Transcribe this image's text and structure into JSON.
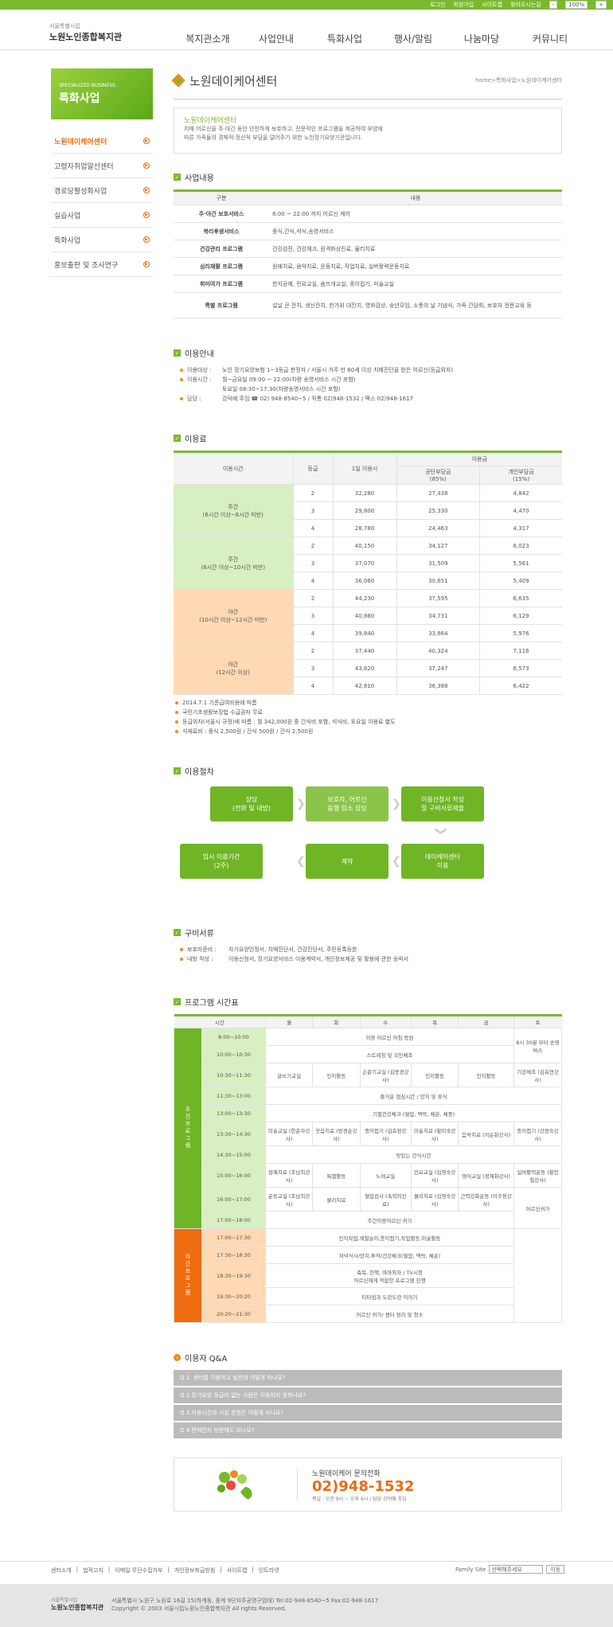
{
  "top_links": [
    "로그인",
    "회원가입",
    "사이트맵",
    "찾아오시는길"
  ],
  "zoom": {
    "minus": "-",
    "value": "100%",
    "plus": "+"
  },
  "logo": {
    "sub": "서울특별시립",
    "name": "노원노인종합복지관"
  },
  "gnb": [
    "복지관소개",
    "사업안내",
    "특화사업",
    "행사/알림",
    "나눔마당",
    "커뮤니티"
  ],
  "lnb_box": {
    "en": "SPECIALIZED BUSINESS",
    "ko": "특화사업"
  },
  "lnb": [
    "노원데이케어센터",
    "고령자취업알선센터",
    "경로당활성화사업",
    "실습사업",
    "특화사업",
    "홍보출판 및 조사연구"
  ],
  "page_title": "노원데이케어센터",
  "breadcrumb": "home>특화사업>노원데이케어센터",
  "intro": {
    "heading": "노원데이케어센터",
    "line1": "치매 어르신을 주·야간 동안 안전하게 보호하고, 전문적인 프로그램을 제공하여 부양에",
    "line2": "따른 가족들의 경제적·정신적 부담을 덜어주기 위한 노인장기요양기관입니다."
  },
  "sec1": {
    "title": "사업내용",
    "col1": "구분",
    "col2": "내용",
    "rows": [
      [
        "주·야간 보호서비스",
        "8:00 ~ 22:00 까지 어르신 케어"
      ],
      [
        "복리후생서비스",
        "중식,간식,석식,송영서비스"
      ],
      [
        "건강관리 프로그램",
        "건강검진, 건강체크, 원격화상진료, 물리치료"
      ],
      [
        "심리재활 프로그램",
        "원예치료, 음악치료, 운동치료, 작업치료, 실버활력운동치료"
      ],
      [
        "취미여가 프로그램",
        "한지공예, 민요교실, 솜뜨개교실, 종이접기, 미술교실"
      ],
      [
        "특별 프로그램",
        "설날 큰 잔치, 생신잔치, 한가위 대잔치, 영화감상, 송년모임, 소풍의 날 기념식, 가족 간담회, 보호자 전문교육 등"
      ]
    ]
  },
  "sec2": {
    "title": "이용안내",
    "rows": [
      {
        "k": "이용대상 :",
        "v": "노인 장기요양보험 1~3등급 판정자 / 서울시 거주 만 60세 이상 치매진단을 받은 어르신(등급외자)"
      },
      {
        "k": "이용시간 :",
        "v": "월~금요일 09:00 ~ 22:00(차량 송영서비스 시간 포함)"
      },
      {
        "k": "",
        "v": "토요일  08:30~17:30(차량송영서비스 시간 포함)"
      },
      {
        "k": "담당 :",
        "v": "강덕예 주임 ☎ 02) 948-8540~5 / 직통 02)948-1532 / 팩스 02)948-1617"
      }
    ]
  },
  "sec3": {
    "title": "이용료",
    "h_time": "이용시간",
    "h_grade": "등급",
    "h_day": "1일 이용시",
    "h_fee": "이용금",
    "h_pub": "공단부담금",
    "h_pub2": "(85%)",
    "h_own": "개인부담금",
    "h_own2": "(15%)",
    "groups": [
      {
        "label1": "주간",
        "label2": "(6시간 이상~8시간 미만)",
        "rows": [
          [
            "2",
            "32,280",
            "27,438",
            "4,842"
          ],
          [
            "3",
            "29,800",
            "25,330",
            "4,470"
          ],
          [
            "4",
            "28,780",
            "24,463",
            "4,317"
          ]
        ]
      },
      {
        "label1": "주간",
        "label2": "(8시간 이상~10시간 미만)",
        "rows": [
          [
            "2",
            "40,150",
            "34,127",
            "6,023"
          ],
          [
            "3",
            "37,070",
            "31,509",
            "5,561"
          ],
          [
            "4",
            "36,060",
            "30,651",
            "5,409"
          ]
        ]
      },
      {
        "label1": "야간",
        "label2": "(10시간 이상~12시간 미만)",
        "rows": [
          [
            "2",
            "44,230",
            "37,595",
            "6,635"
          ],
          [
            "3",
            "40,860",
            "34,731",
            "6,129"
          ],
          [
            "4",
            "39,840",
            "33,864",
            "5,976"
          ]
        ]
      },
      {
        "label1": "야간",
        "label2": "(12시간 이상)",
        "rows": [
          [
            "2",
            "37,440",
            "40,324",
            "7,116"
          ],
          [
            "3",
            "43,820",
            "37,247",
            "6,573"
          ],
          [
            "4",
            "42,810",
            "36,388",
            "6,422"
          ]
        ]
      }
    ],
    "notes": [
      "2014.7.1 기준급여비용에 따름",
      "국민기초생활보장법 수급권자 무료",
      "등급외자(서울시 규정)에 따름 : 월 342,000원 중 간식비 포함, 석식비, 토요일 이용료 별도",
      "식재료비 : 중식 2,500원 / 간식 500원 / 간식 2,500원"
    ]
  },
  "sec4": {
    "title": "이용절차",
    "s1a": "상담",
    "s1b": "(전화 및 내방)",
    "s2a": "보호자, 어르신",
    "s2b": "동행 입소 상담",
    "s3a": "이용신청서 작성",
    "s3b": "및 구비서류제출",
    "s4a": "데이케어센터",
    "s4b": "이용",
    "s5": "계약",
    "s6a": "임시 이용기간",
    "s6b": "(2주)"
  },
  "sec5": {
    "title": "구비서류",
    "rows": [
      {
        "k": "보호자준비 :",
        "v": "자기요양인정서, 치매진단서, 건강진단서, 주민등록등본"
      },
      {
        "k": "내방 작성 :",
        "v": "이용신청서, 장기요양서비스 이용계약서, 개인정보제공 및 활용에 관한 승락서"
      }
    ]
  },
  "sec6": {
    "title": "프로그램 시간표",
    "h": [
      "시간",
      "월",
      "화",
      "수",
      "목",
      "금",
      "토"
    ],
    "day_label": "주간프로그램",
    "night_label": "야간프로그램",
    "r1": {
      "t": "8:00~10:00",
      "v": "이용 어르신 아침 등원",
      "sat": "8시 30분 부터 송영버스"
    },
    "r2": {
      "t": "10:00~10:30",
      "v": "스트레칭 및 국민체조"
    },
    "r3": {
      "t": "10:30~11:30",
      "c": [
        "글쓰기교실",
        "인지활동",
        "손끝기교실 (김봉경강사)",
        "인지활동",
        "인지활동",
        "기공체조 (김옥연강사)"
      ]
    },
    "r4": {
      "t": "11:30~13:00",
      "v": "즐거운 점심시간 / 양치 및 휴식"
    },
    "r5": {
      "t": "13:00~13:30",
      "v": "기별건강체크 (혈압, 맥박, 체온, 체중)"
    },
    "r6": {
      "t": "13:30~14:30",
      "c": [
        "미술교실 (한춘자강사)",
        "웃음치료 (방경순강사)",
        "종이접기 (김효정강사)",
        "미술치료 (황미숙강사)",
        "음악치료 (이순화강사)",
        "종이접기 (강정숙강사)"
      ]
    },
    "r7": {
      "t": "14:30~15:00",
      "v": "맛있는 간식시간"
    },
    "r8": {
      "t": "15:00~16:00",
      "c": [
        "원예치료 (조남희강사)",
        "특별활동",
        "노래교실",
        "민요교실 (김영숙강사)",
        "영어교실 (정재화강사)",
        "실버활력운동 (황인철강사)"
      ]
    },
    "r9": {
      "t": "16:00~17:00",
      "c": [
        "운동교실 (조남희강사)",
        "물리치료",
        "혈압검사 (속학의진료)",
        "물리치료 (김영숙강사)",
        "근력강화운동 (이주용강사)"
      ],
      "sat": "어르신귀가"
    },
    "r10": {
      "t": "17:00~18:00",
      "v": "주간이용어르신 귀가"
    },
    "r11": {
      "t": "17:00~17:30",
      "v": "인지작업,색칠놀이,종이접기,작업활동,미술활동"
    },
    "r12": {
      "t": "17:30~18:30",
      "v": "저녁식사/양치,투약/건강체크(혈압, 맥박, 체온)"
    },
    "r13": {
      "t": "18:30~19:30",
      "v1": "축복, 현책, 마마외자 / TV시청",
      "v2": "어르신에게 적합한 프로그램 진행"
    },
    "r14": {
      "t": "19:30~20:20",
      "v": "티타임과 도란도란 이야기"
    },
    "r15": {
      "t": "20:20~21:30",
      "v": "어르신 귀가/ 센터 정리 및 청소"
    }
  },
  "sec7": {
    "title": "이용자 Q&A",
    "items": [
      "Q 1. 센터를 이용하고 싶은데 어떻게 하나요?",
      "Q 2.장기요양 등급이 없는 사람은 이용하지 못하나요?",
      "Q 3.이용시간과 시설 운영은 어떻게 되나요?",
      "Q 4.면제인지 방문해도 되나요?"
    ]
  },
  "call": {
    "label": "노원데이케어 문의전화",
    "phone": "02)948-1532",
    "hours": "평일 : 오전 9시 ~ 오후 6시 / 담당 강덕예 주임"
  },
  "footer": {
    "links": [
      "센터소개",
      "법적고지",
      "이메일 무단수집거부",
      "개인정보취급방침",
      "사이트맵",
      "인트라넷"
    ],
    "family_label": "Family Site",
    "family_select": "선택해주세요",
    "family_go": "이동",
    "logo_sub": "서울특별시립",
    "logo_name": "노원노인종합복지관",
    "addr": "서울특별시 노원구 노원로 16길 15(하계동, 중계 9단지주공영구임대) Tel:02-948-8540~5 Fax:02-948-1617",
    "copy": "Copyright © 2003 서울시립노원노인종합복지관 All rights Reserved."
  }
}
